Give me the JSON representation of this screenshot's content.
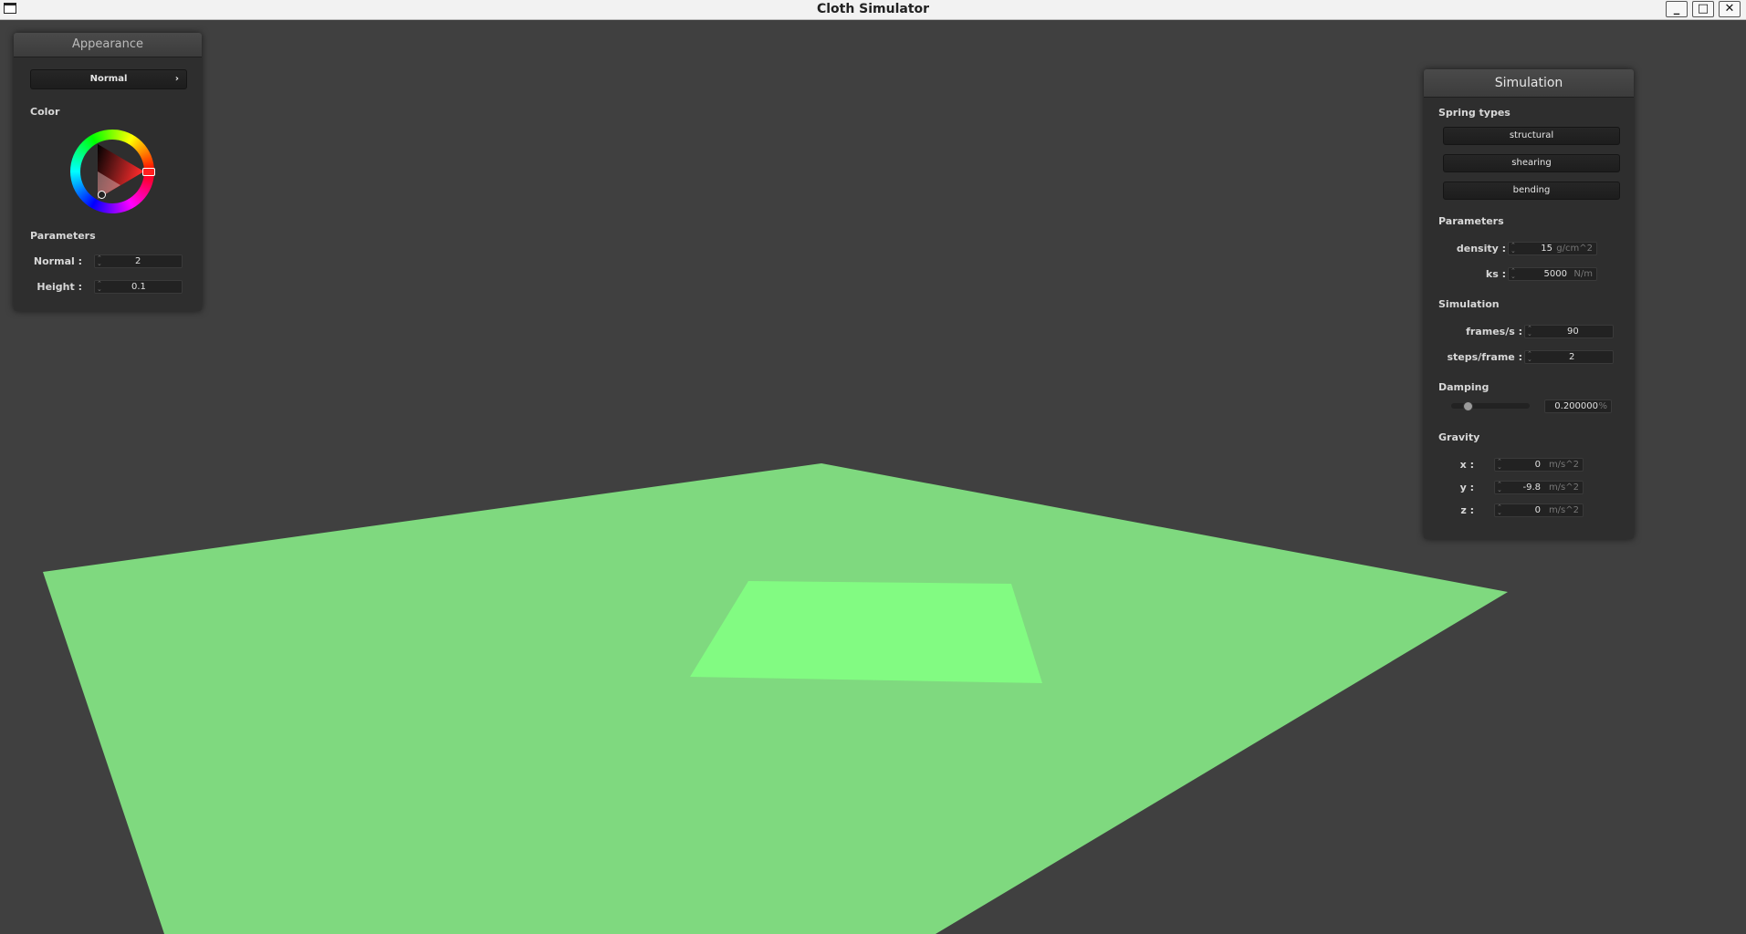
{
  "window": {
    "title": "Cloth Simulator",
    "minimize_label": "_",
    "maximize_label": "□",
    "close_label": "✕"
  },
  "scene": {
    "cloth_color": "#7fd97f",
    "patch_color": "#82fb82",
    "background_color": "#404040"
  },
  "appearance": {
    "title": "Appearance",
    "shader_selected": "Normal",
    "shader_arrow": "›",
    "color_label": "Color",
    "parameters_label": "Parameters",
    "normal_label": "Normal :",
    "normal_value": "2",
    "height_label": "Height :",
    "height_value": "0.1"
  },
  "simulation": {
    "title": "Simulation",
    "spring_types_label": "Spring types",
    "springs": [
      "structural",
      "shearing",
      "bending"
    ],
    "parameters_label": "Parameters",
    "density_label": "density :",
    "density_value": "15",
    "density_unit": "g/cm^2",
    "ks_label": "ks :",
    "ks_value": "5000",
    "ks_unit": "N/m",
    "simulation_label": "Simulation",
    "fps_label": "frames/s :",
    "fps_value": "90",
    "steps_label": "steps/frame :",
    "steps_value": "2",
    "damping_label": "Damping",
    "damping_value": "0.200000",
    "damping_unit": "%",
    "damping_fraction": 0.2,
    "gravity_label": "Gravity",
    "gx_label": "x :",
    "gx_value": "0",
    "gy_label": "y :",
    "gy_value": "-9.8",
    "gz_label": "z :",
    "gz_value": "0",
    "gravity_unit": "m/s^2"
  }
}
